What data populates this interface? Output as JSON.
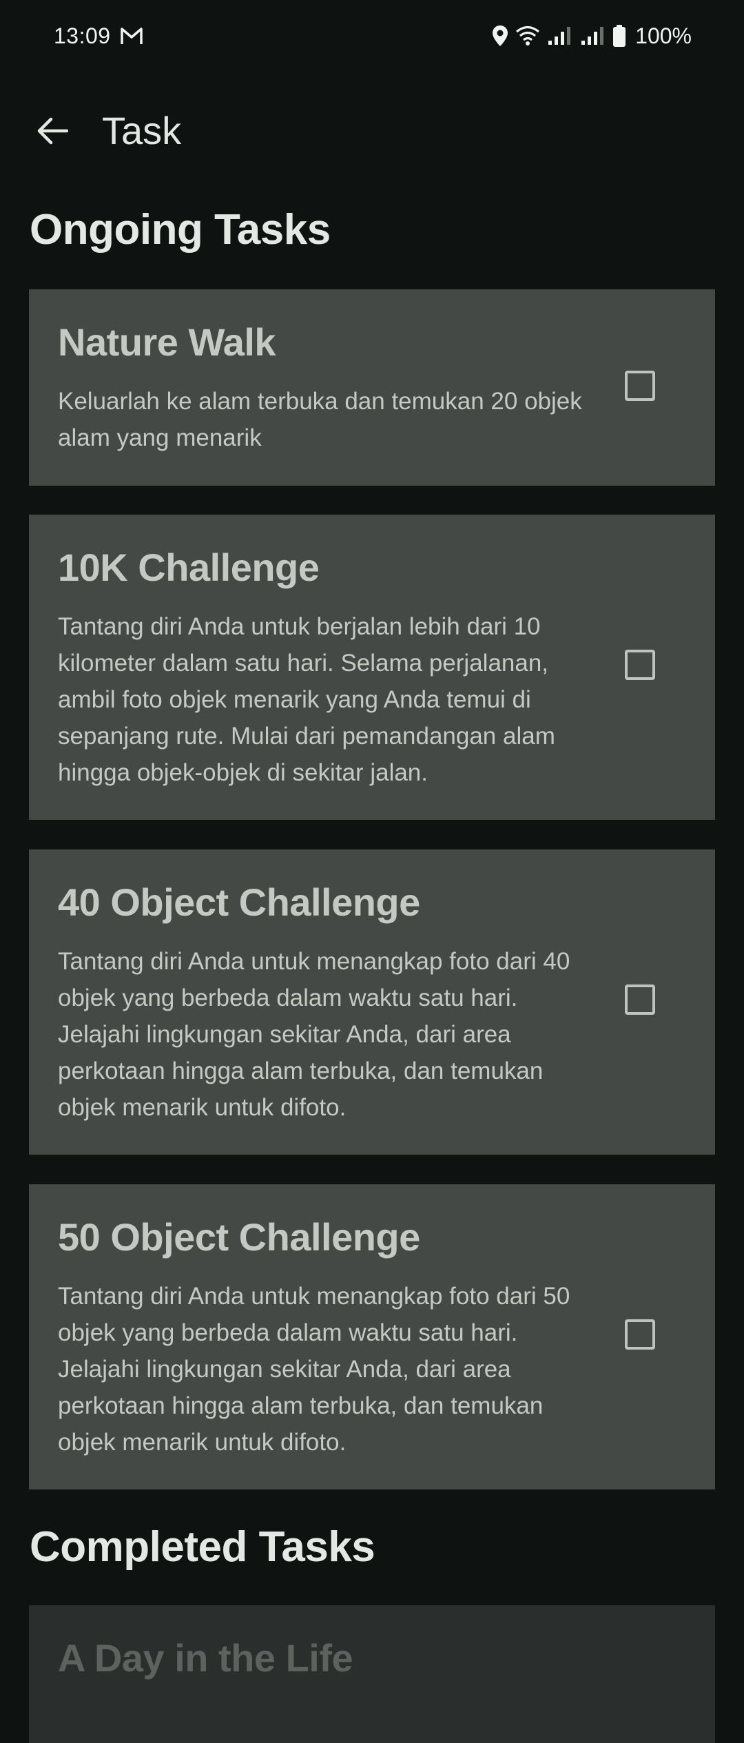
{
  "status_bar": {
    "time": "13:09",
    "battery": "100%",
    "icons": [
      "gmail-icon",
      "location-icon",
      "wifi-icon",
      "signal-icon",
      "signal-icon",
      "battery-icon"
    ]
  },
  "app_bar": {
    "title": "Task",
    "back_icon": "arrow-back-icon"
  },
  "sections": {
    "ongoing_title": "Ongoing Tasks",
    "completed_title": "Completed Tasks"
  },
  "ongoing_tasks": [
    {
      "title": "Nature Walk",
      "description": "Keluarlah ke alam terbuka dan temukan 20 objek alam yang menarik",
      "checked": false
    },
    {
      "title": "10K Challenge",
      "description": "Tantang diri Anda untuk berjalan lebih dari 10 kilometer dalam satu hari. Selama perjalanan, ambil foto objek menarik yang Anda temui di sepanjang rute. Mulai dari pemandangan alam hingga objek-objek di sekitar jalan.",
      "checked": false
    },
    {
      "title": "40 Object Challenge",
      "description": "Tantang diri Anda untuk menangkap foto dari 40 objek yang berbeda dalam waktu satu hari. Jelajahi lingkungan sekitar Anda, dari area perkotaan hingga alam terbuka, dan temukan objek menarik untuk difoto.",
      "checked": false
    },
    {
      "title": "50 Object Challenge",
      "description": "Tantang diri Anda untuk menangkap foto dari 50 objek yang berbeda dalam waktu satu hari. Jelajahi lingkungan sekitar Anda, dari area perkotaan hingga alam terbuka, dan temukan objek menarik untuk difoto.",
      "checked": false
    }
  ],
  "completed_tasks": [
    {
      "title": "A Day in the Life"
    }
  ],
  "colors": {
    "background": "#0e1312",
    "card": "#444946",
    "text": "#c4c9c4",
    "heading": "#e4e8e4"
  }
}
